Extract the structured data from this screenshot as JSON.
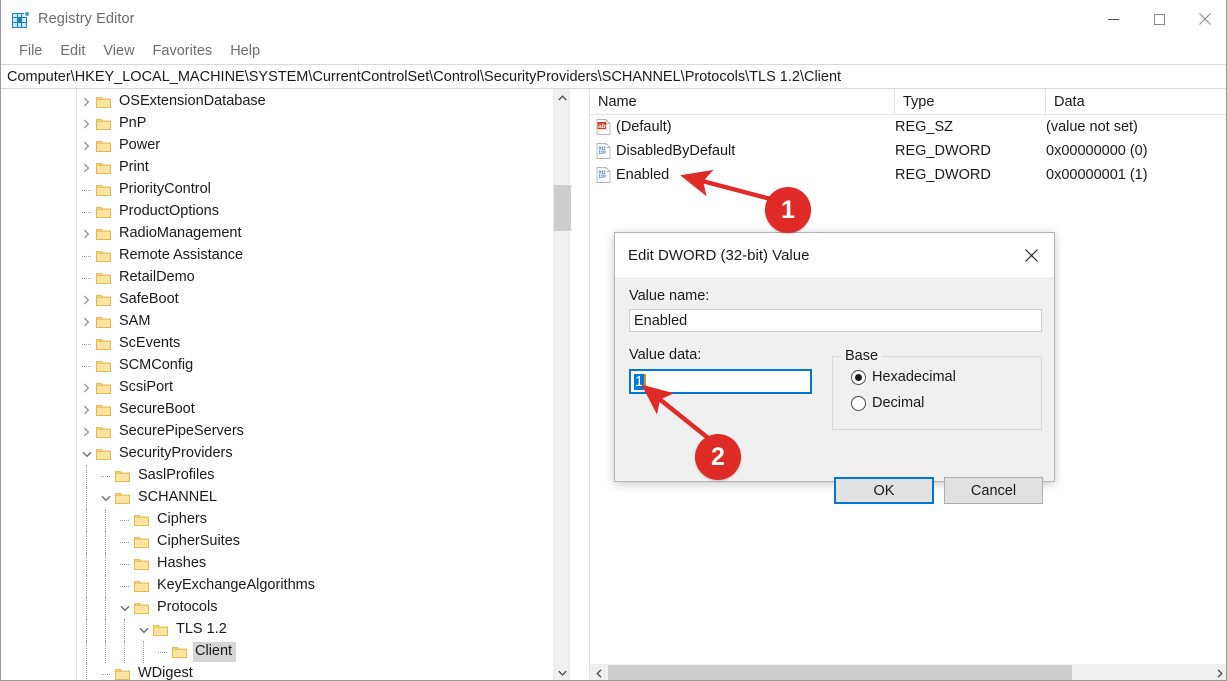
{
  "window": {
    "title": "Registry Editor",
    "icon": "registry-editor-icon",
    "controls": {
      "minimize": "minimize-button",
      "maximize": "maximize-button",
      "close": "close-button"
    }
  },
  "menu": {
    "items": [
      {
        "label": "File"
      },
      {
        "label": "Edit"
      },
      {
        "label": "View"
      },
      {
        "label": "Favorites"
      },
      {
        "label": "Help"
      }
    ]
  },
  "address": {
    "path": "Computer\\HKEY_LOCAL_MACHINE\\SYSTEM\\CurrentControlSet\\Control\\SecurityProviders\\SCHANNEL\\Protocols\\TLS 1.2\\Client"
  },
  "tree": {
    "items": [
      {
        "label": "OSExtensionDatabase",
        "indent": 0,
        "twisty": "collapsed",
        "selected": false
      },
      {
        "label": "PnP",
        "indent": 0,
        "twisty": "collapsed",
        "selected": false
      },
      {
        "label": "Power",
        "indent": 0,
        "twisty": "collapsed",
        "selected": false
      },
      {
        "label": "Print",
        "indent": 0,
        "twisty": "collapsed",
        "selected": false
      },
      {
        "label": "PriorityControl",
        "indent": 0,
        "twisty": "none",
        "selected": false
      },
      {
        "label": "ProductOptions",
        "indent": 0,
        "twisty": "none",
        "selected": false
      },
      {
        "label": "RadioManagement",
        "indent": 0,
        "twisty": "collapsed",
        "selected": false
      },
      {
        "label": "Remote Assistance",
        "indent": 0,
        "twisty": "none",
        "selected": false
      },
      {
        "label": "RetailDemo",
        "indent": 0,
        "twisty": "none",
        "selected": false
      },
      {
        "label": "SafeBoot",
        "indent": 0,
        "twisty": "collapsed",
        "selected": false
      },
      {
        "label": "SAM",
        "indent": 0,
        "twisty": "collapsed",
        "selected": false
      },
      {
        "label": "ScEvents",
        "indent": 0,
        "twisty": "none",
        "selected": false
      },
      {
        "label": "SCMConfig",
        "indent": 0,
        "twisty": "none",
        "selected": false
      },
      {
        "label": "ScsiPort",
        "indent": 0,
        "twisty": "collapsed",
        "selected": false
      },
      {
        "label": "SecureBoot",
        "indent": 0,
        "twisty": "collapsed",
        "selected": false
      },
      {
        "label": "SecurePipeServers",
        "indent": 0,
        "twisty": "collapsed",
        "selected": false
      },
      {
        "label": "SecurityProviders",
        "indent": 0,
        "twisty": "expanded",
        "selected": false
      },
      {
        "label": "SaslProfiles",
        "indent": 1,
        "twisty": "none",
        "selected": false
      },
      {
        "label": "SCHANNEL",
        "indent": 1,
        "twisty": "expanded",
        "selected": false
      },
      {
        "label": "Ciphers",
        "indent": 2,
        "twisty": "none",
        "selected": false
      },
      {
        "label": "CipherSuites",
        "indent": 2,
        "twisty": "none",
        "selected": false
      },
      {
        "label": "Hashes",
        "indent": 2,
        "twisty": "none",
        "selected": false
      },
      {
        "label": "KeyExchangeAlgorithms",
        "indent": 2,
        "twisty": "none",
        "selected": false
      },
      {
        "label": "Protocols",
        "indent": 2,
        "twisty": "expanded",
        "selected": false
      },
      {
        "label": "TLS 1.2",
        "indent": 3,
        "twisty": "expanded",
        "selected": false
      },
      {
        "label": "Client",
        "indent": 4,
        "twisty": "none",
        "selected": true
      },
      {
        "label": "WDigest",
        "indent": 1,
        "twisty": "none",
        "selected": false
      }
    ]
  },
  "values": {
    "columns": [
      "Name",
      "Type",
      "Data"
    ],
    "rows": [
      {
        "name": "(Default)",
        "type": "REG_SZ",
        "data": "(value not set)",
        "icon": "string-value-icon"
      },
      {
        "name": "DisabledByDefault",
        "type": "REG_DWORD",
        "data": "0x00000000 (0)",
        "icon": "dword-value-icon"
      },
      {
        "name": "Enabled",
        "type": "REG_DWORD",
        "data": "0x00000001 (1)",
        "icon": "dword-value-icon"
      }
    ]
  },
  "dialog": {
    "title": "Edit DWORD (32-bit) Value",
    "value_name_label": "Value name:",
    "value_name": "Enabled",
    "value_data_label": "Value data:",
    "value_data": "1",
    "base": {
      "legend": "Base",
      "options": [
        {
          "label": "Hexadecimal",
          "selected": true
        },
        {
          "label": "Decimal",
          "selected": false
        }
      ]
    },
    "buttons": {
      "ok": "OK",
      "cancel": "Cancel"
    }
  },
  "annotations": [
    {
      "id": "1",
      "label": "1",
      "target": "enabled-value-row"
    },
    {
      "id": "2",
      "label": "2",
      "target": "value-data-input"
    }
  ],
  "colors": {
    "accent": "#0078d7",
    "annotation": "#e02a26",
    "folder": "#ffd976",
    "selection": "#d5d5d5"
  }
}
